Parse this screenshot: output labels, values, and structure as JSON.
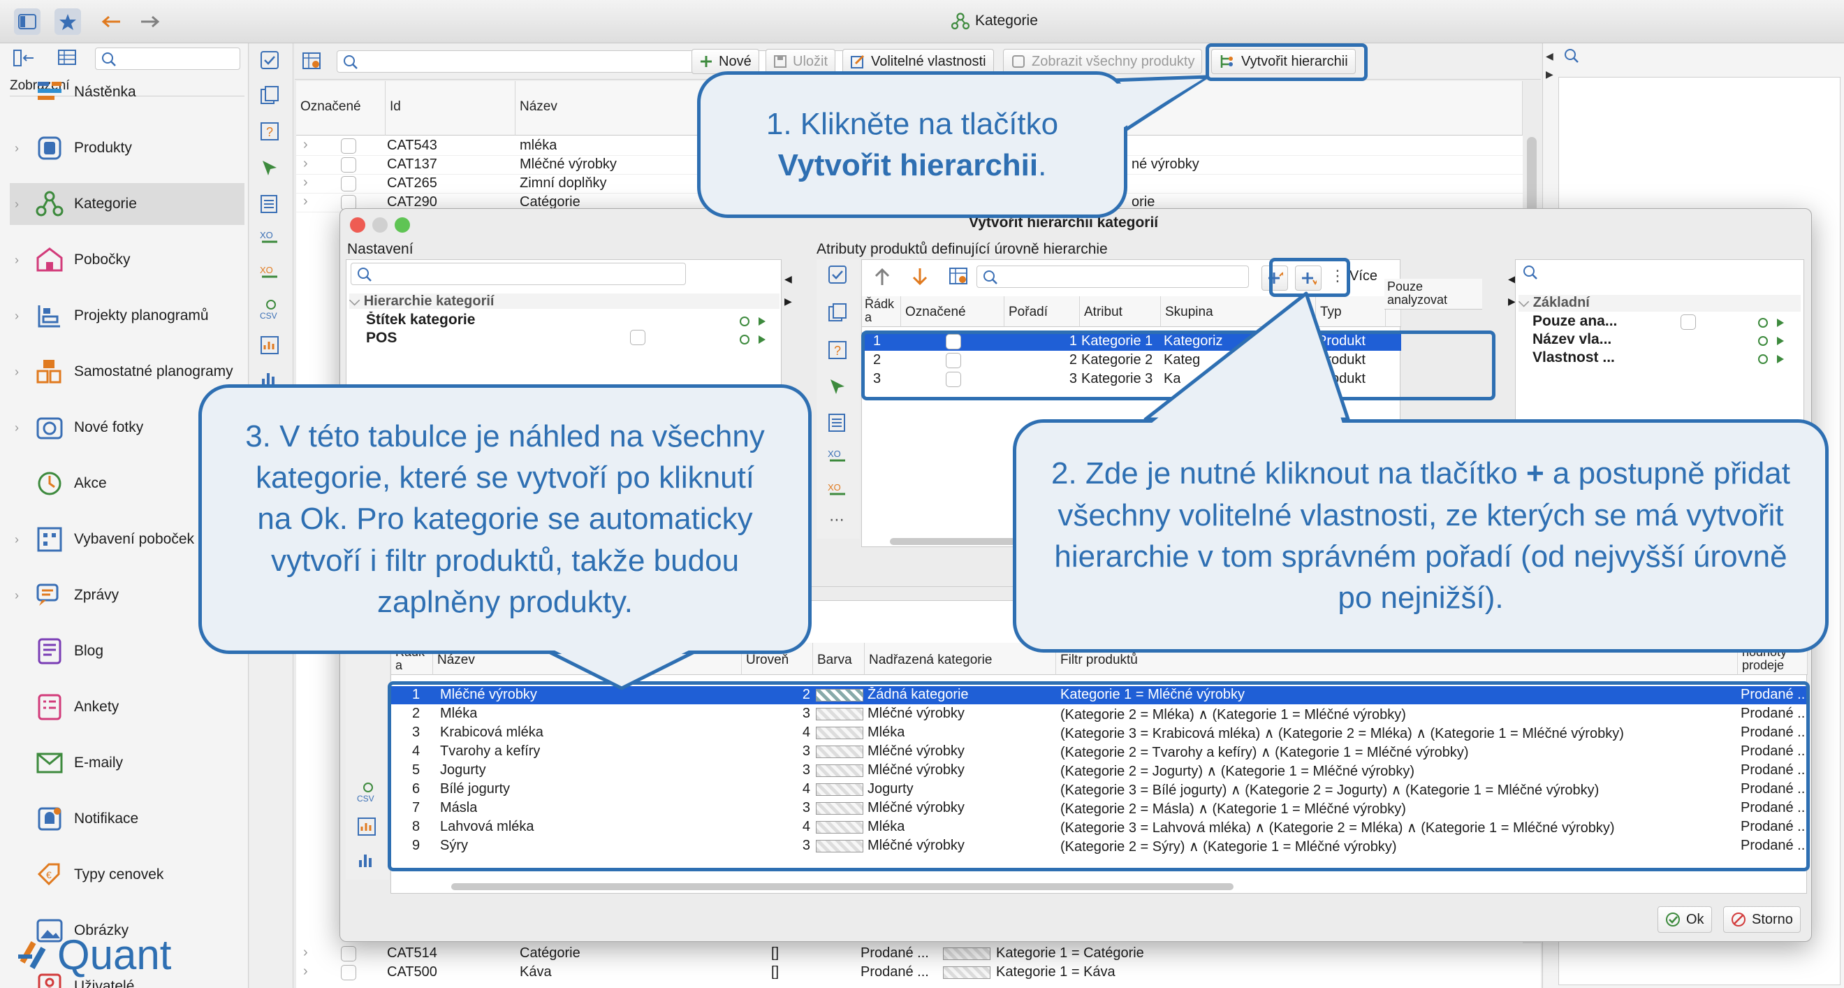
{
  "window": {
    "title": "Kategorie"
  },
  "sidebar": {
    "section_label": "Zobrazení",
    "items": [
      {
        "label": "Nástěnka",
        "icon": "dashboard-icon"
      },
      {
        "label": "Produkty",
        "icon": "products-icon"
      },
      {
        "label": "Kategorie",
        "icon": "categories-icon"
      },
      {
        "label": "Pobočky",
        "icon": "store-icon"
      },
      {
        "label": "Projekty planogramů",
        "icon": "planogram-projects-icon"
      },
      {
        "label": "Samostatné planogramy",
        "icon": "planograms-icon"
      },
      {
        "label": "Nové fotky",
        "icon": "camera-icon"
      },
      {
        "label": "Akce",
        "icon": "clock-icon"
      },
      {
        "label": "Vybavení poboček",
        "icon": "equipment-icon"
      },
      {
        "label": "Zprávy",
        "icon": "messages-icon"
      },
      {
        "label": "Blog",
        "icon": "blog-icon"
      },
      {
        "label": "Ankety",
        "icon": "survey-icon"
      },
      {
        "label": "E-maily",
        "icon": "mail-icon"
      },
      {
        "label": "Notifikace",
        "icon": "bell-icon"
      },
      {
        "label": "Typy cenovek",
        "icon": "price-tag-icon"
      },
      {
        "label": "Obrázky",
        "icon": "image-icon"
      },
      {
        "label": "Uživatelé",
        "icon": "user-icon"
      }
    ],
    "logo": "Quant"
  },
  "toolbar": {
    "new_label": "Nové",
    "save_label": "Uložit",
    "optional_props_label": "Volitelné vlastnosti",
    "show_all_products_label": "Zobrazit všechny produkty",
    "create_hierarchy_label": "Vytvořit hierarchii"
  },
  "main_table": {
    "headers": [
      "Označené",
      "Id",
      "Název"
    ],
    "rows": [
      {
        "id": "CAT543",
        "name": "mléka",
        "extra": ""
      },
      {
        "id": "CAT137",
        "name": "Mléčné výrobky",
        "extra": "né výrobky"
      },
      {
        "id": "CAT265",
        "name": "Zimní doplňky",
        "extra": ""
      },
      {
        "id": "CAT290",
        "name": "Catégorie",
        "extra": "orie"
      }
    ],
    "bottom_rows": [
      {
        "id": "CAT514",
        "name": "Catégorie",
        "brackets": "[]",
        "sales": "Prodané ...",
        "filter": "Kategorie 1 = Catégorie"
      },
      {
        "id": "CAT500",
        "name": "Káva",
        "brackets": "[]",
        "sales": "Prodané ...",
        "filter": "Kategorie 1 = Káva"
      }
    ]
  },
  "dialog": {
    "title": "Vytvořit hierarchii kategorií",
    "settings": {
      "label": "Nastavení",
      "tree_root": "Hierarchie kategorií",
      "items": [
        "Štítek kategorie",
        "POS"
      ]
    },
    "attributes": {
      "label": "Atributy produktů definující úrovně hierarchie",
      "more_label": "Více",
      "headers": [
        "Řádk a",
        "Označené",
        "Pořadí",
        "Atribut",
        "Skupina",
        "Typ",
        "Pouze analyzovat"
      ],
      "rows": [
        {
          "row": "1",
          "order": "1",
          "attr": "Kategorie 1",
          "group": "Kategoriz",
          "type": "Produkt"
        },
        {
          "row": "2",
          "order": "2",
          "attr": "Kategorie 2",
          "group": "Kateg",
          "type": "Produkt"
        },
        {
          "row": "3",
          "order": "3",
          "attr": "Kategorie 3",
          "group": "Ka",
          "type": "Produkt"
        }
      ]
    },
    "properties": {
      "group_label": "Základní",
      "items": [
        "Pouze ana...",
        "Název vla...",
        "Vlastnost ..."
      ]
    },
    "preview": {
      "headers": [
        "Řádk a",
        "Název",
        "Úroveň",
        "Barva",
        "Nadřazená kategorie",
        "Filtr produktů",
        "hodnoty prodeje"
      ],
      "rows": [
        {
          "row": "1",
          "name": "Mléčné výrobky",
          "level": "2",
          "parent": "Žádná kategorie",
          "filter": "Kategorie 1 = Mléčné výrobky",
          "sales": "Prodané ..."
        },
        {
          "row": "2",
          "name": "Mléka",
          "level": "3",
          "parent": "Mléčné výrobky",
          "filter": "(Kategorie 2 = Mléka) ∧ (Kategorie 1 = Mléčné výrobky)",
          "sales": "Prodané ..."
        },
        {
          "row": "3",
          "name": "Krabicová mléka",
          "level": "4",
          "parent": "Mléka",
          "filter": "(Kategorie 3 = Krabicová mléka) ∧ (Kategorie 2 = Mléka) ∧ (Kategorie 1 = Mléčné výrobky)",
          "sales": "Prodané ..."
        },
        {
          "row": "4",
          "name": "Tvarohy a kefíry",
          "level": "3",
          "parent": "Mléčné výrobky",
          "filter": "(Kategorie 2 = Tvarohy a kefíry) ∧ (Kategorie 1 = Mléčné výrobky)",
          "sales": "Prodané ..."
        },
        {
          "row": "5",
          "name": "Jogurty",
          "level": "3",
          "parent": "Mléčné výrobky",
          "filter": "(Kategorie 2 = Jogurty) ∧ (Kategorie 1 = Mléčné výrobky)",
          "sales": "Prodané ..."
        },
        {
          "row": "6",
          "name": "Bílé jogurty",
          "level": "4",
          "parent": "Jogurty",
          "filter": "(Kategorie 3 = Bílé jogurty) ∧ (Kategorie 2 = Jogurty) ∧ (Kategorie 1 = Mléčné výrobky)",
          "sales": "Prodané ..."
        },
        {
          "row": "7",
          "name": "Másla",
          "level": "3",
          "parent": "Mléčné výrobky",
          "filter": "(Kategorie 2 = Másla) ∧ (Kategorie 1 = Mléčné výrobky)",
          "sales": "Prodané ..."
        },
        {
          "row": "8",
          "name": "Lahvová mléka",
          "level": "4",
          "parent": "Mléka",
          "filter": "(Kategorie 3 = Lahvová mléka) ∧ (Kategorie 2 = Mléka) ∧ (Kategorie 1 = Mléčné výrobky)",
          "sales": "Prodané ..."
        },
        {
          "row": "9",
          "name": "Sýry",
          "level": "3",
          "parent": "Mléčné výrobky",
          "filter": "(Kategorie 2 = Sýry) ∧ (Kategorie 1 = Mléčné výrobky)",
          "sales": "Prodané ..."
        }
      ]
    },
    "ok_label": "Ok",
    "cancel_label": "Storno"
  },
  "callouts": {
    "c1_line1": "1. Klikněte na tlačítko",
    "c1_bold": "Vytvořit hierarchii",
    "c1_end": ".",
    "c2_pre": "2. Zde je nutné kliknout na tlačítko ",
    "c2_plus": "+",
    "c2_post": " a postupně přidat všechny volitelné vlastnosti, ze kterých se má vytvořit hierarchie v tom správném pořadí (od nejvyšší úrovně po nejnižší).",
    "c3": "3. V této tabulce je náhled na všechny kategorie, které se vytvoří po kliknutí na Ok. Pro kategorie se automaticky vytvoří i filtr produktů, takže budou zaplněny produkty."
  },
  "colors": {
    "accent": "#2e6fb2",
    "selection": "#1f5fd6",
    "callout_bg": "#eaf0f6"
  }
}
